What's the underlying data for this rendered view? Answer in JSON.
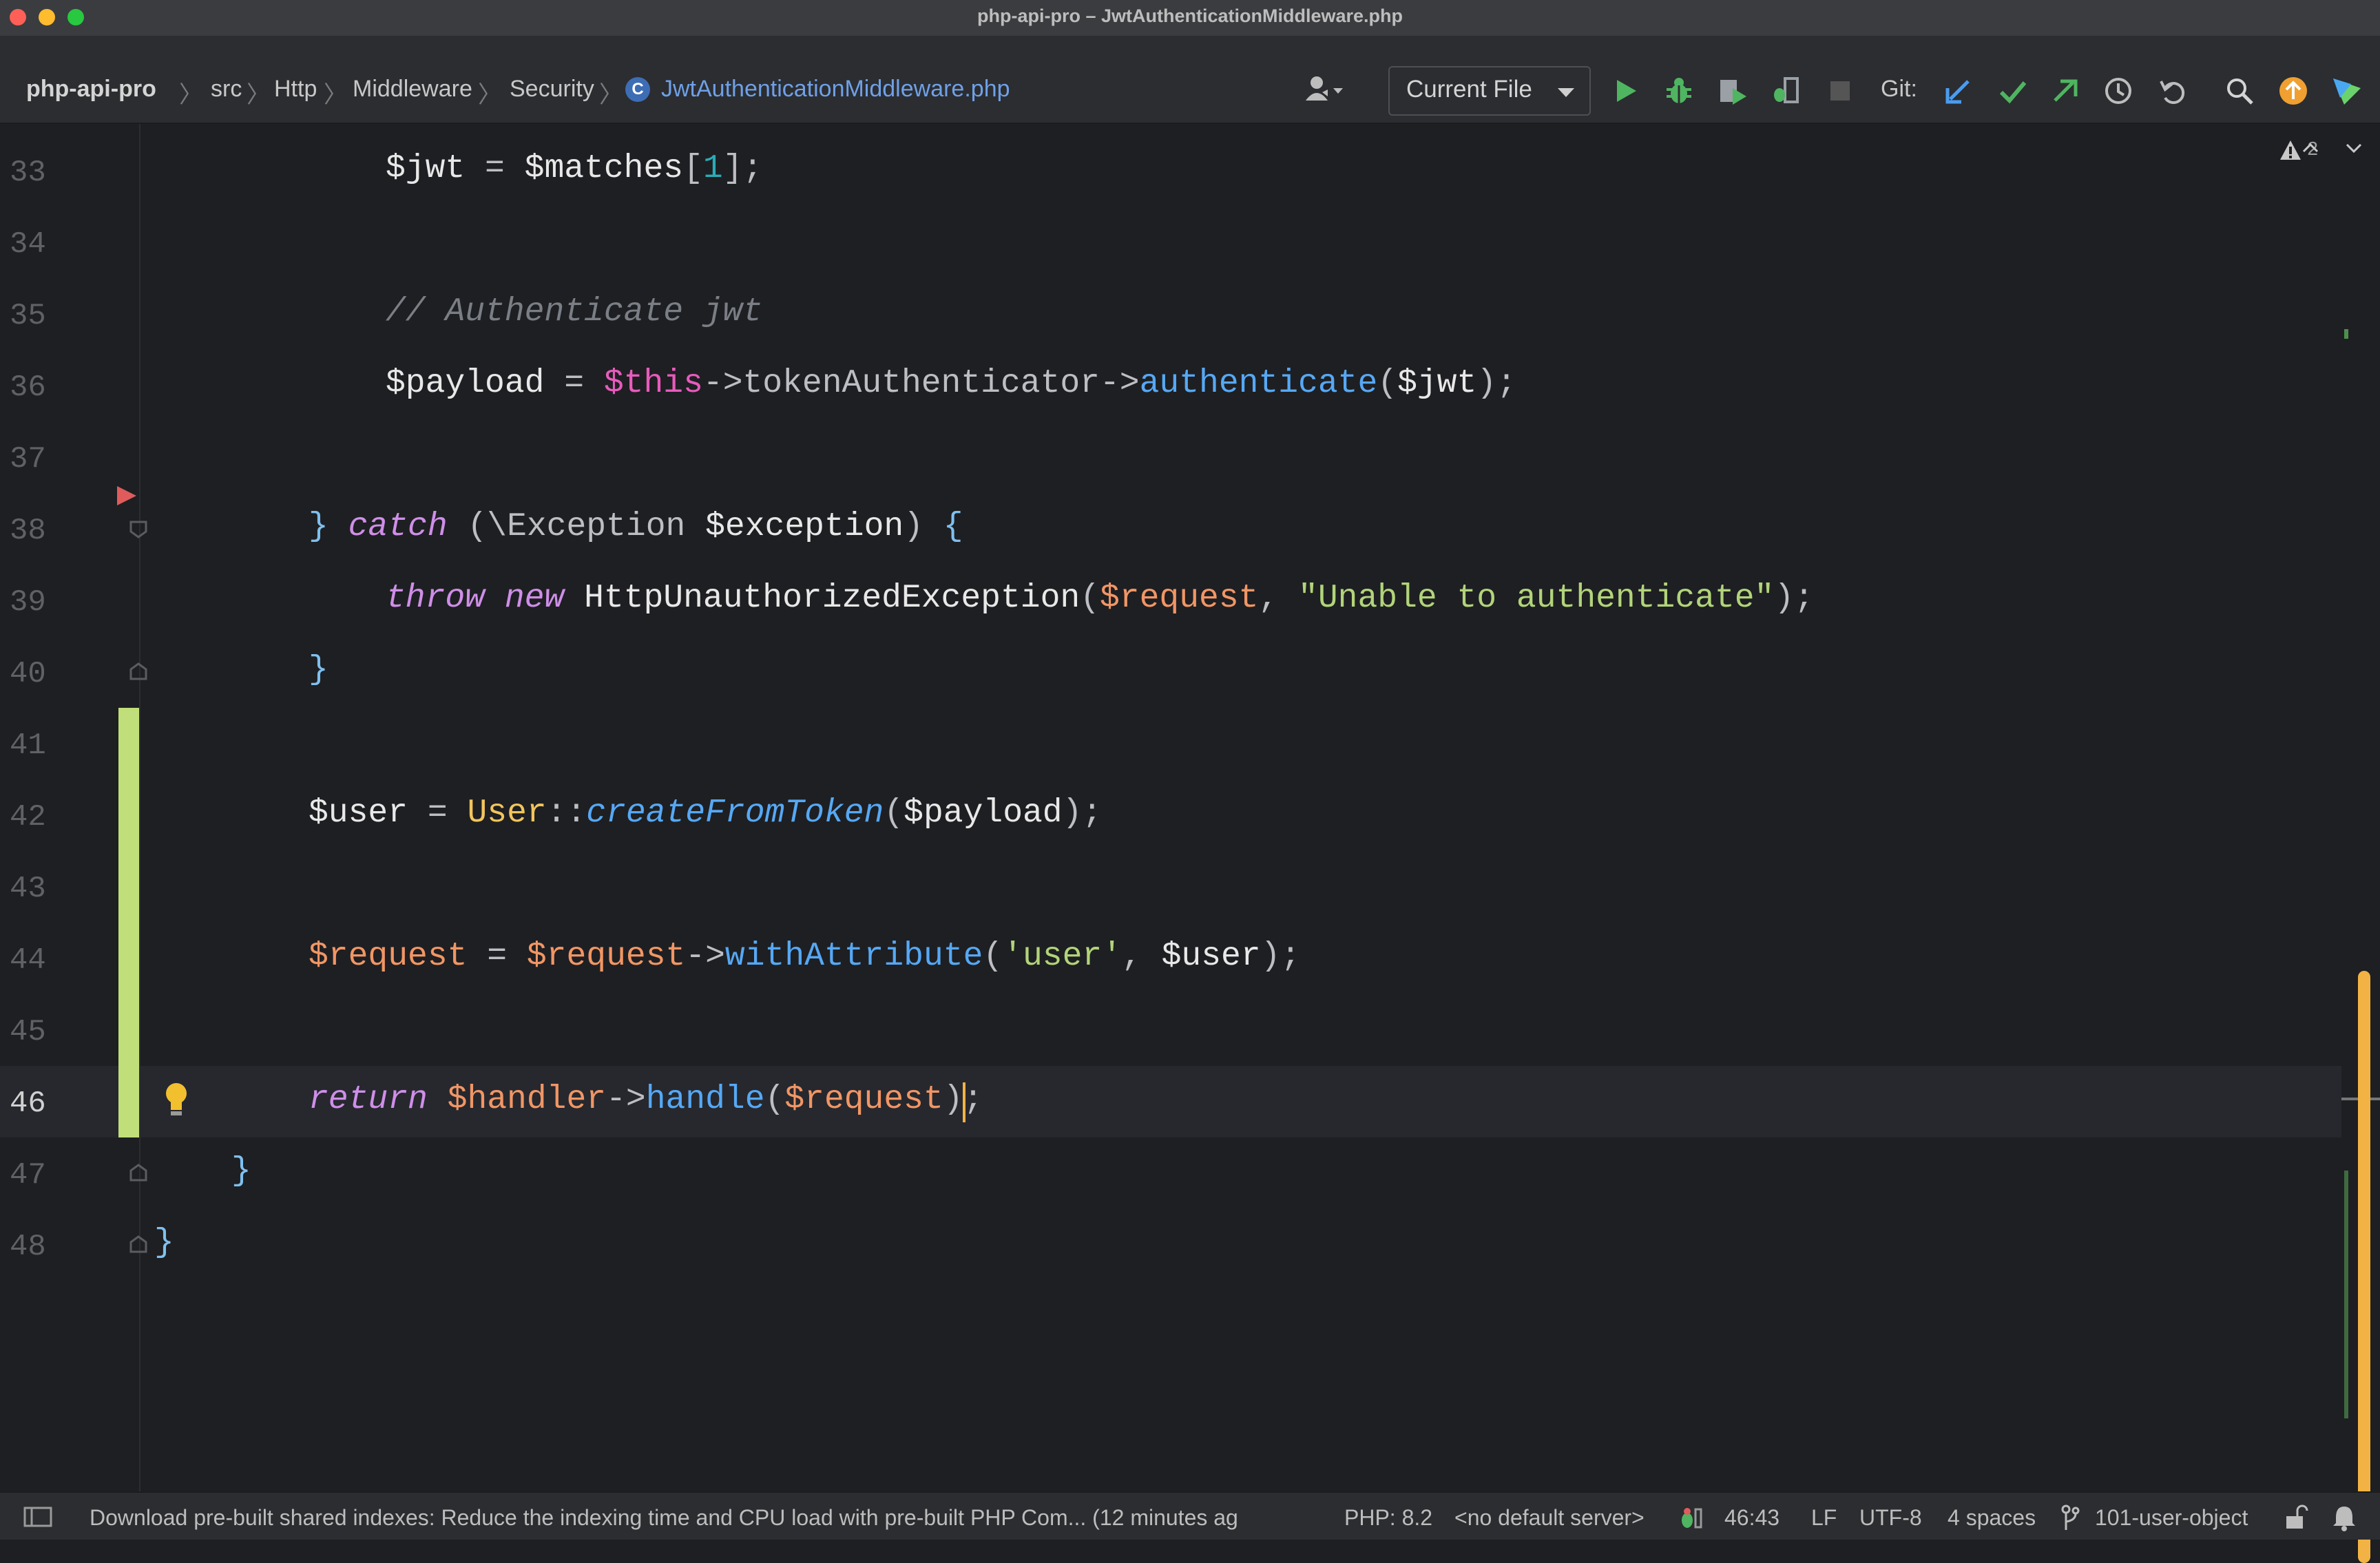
{
  "window": {
    "title": "php-api-pro – JwtAuthenticationMiddleware.php"
  },
  "breadcrumbs": [
    "php-api-pro",
    "src",
    "Http",
    "Middleware",
    "Security",
    "JwtAuthenticationMiddleware.php"
  ],
  "class_icon_letter": "C",
  "toolbar": {
    "run_config": "Current File",
    "git_label": "Git:"
  },
  "editor": {
    "inspections_count": "2",
    "line_numbers": [
      "33",
      "34",
      "35",
      "36",
      "37",
      "38",
      "39",
      "40",
      "41",
      "42",
      "43",
      "44",
      "45",
      "46",
      "47",
      "48"
    ]
  },
  "status": {
    "message": "Download pre-built shared indexes: Reduce the indexing time and CPU load with pre-built PHP Com... (12 minutes ag",
    "php_version": "PHP: 8.2",
    "server": "<no default server>",
    "position": "46:43",
    "line_ending": "LF",
    "encoding": "UTF-8",
    "indent": "4 spaces",
    "branch": "101-user-object"
  },
  "colors": {
    "accent_yellow": "#f2b344",
    "change_green": "#c0df7a",
    "keyword": "#cf8ee8",
    "string": "#b2d47a",
    "method": "#56a8f5",
    "param": "#f19665"
  }
}
